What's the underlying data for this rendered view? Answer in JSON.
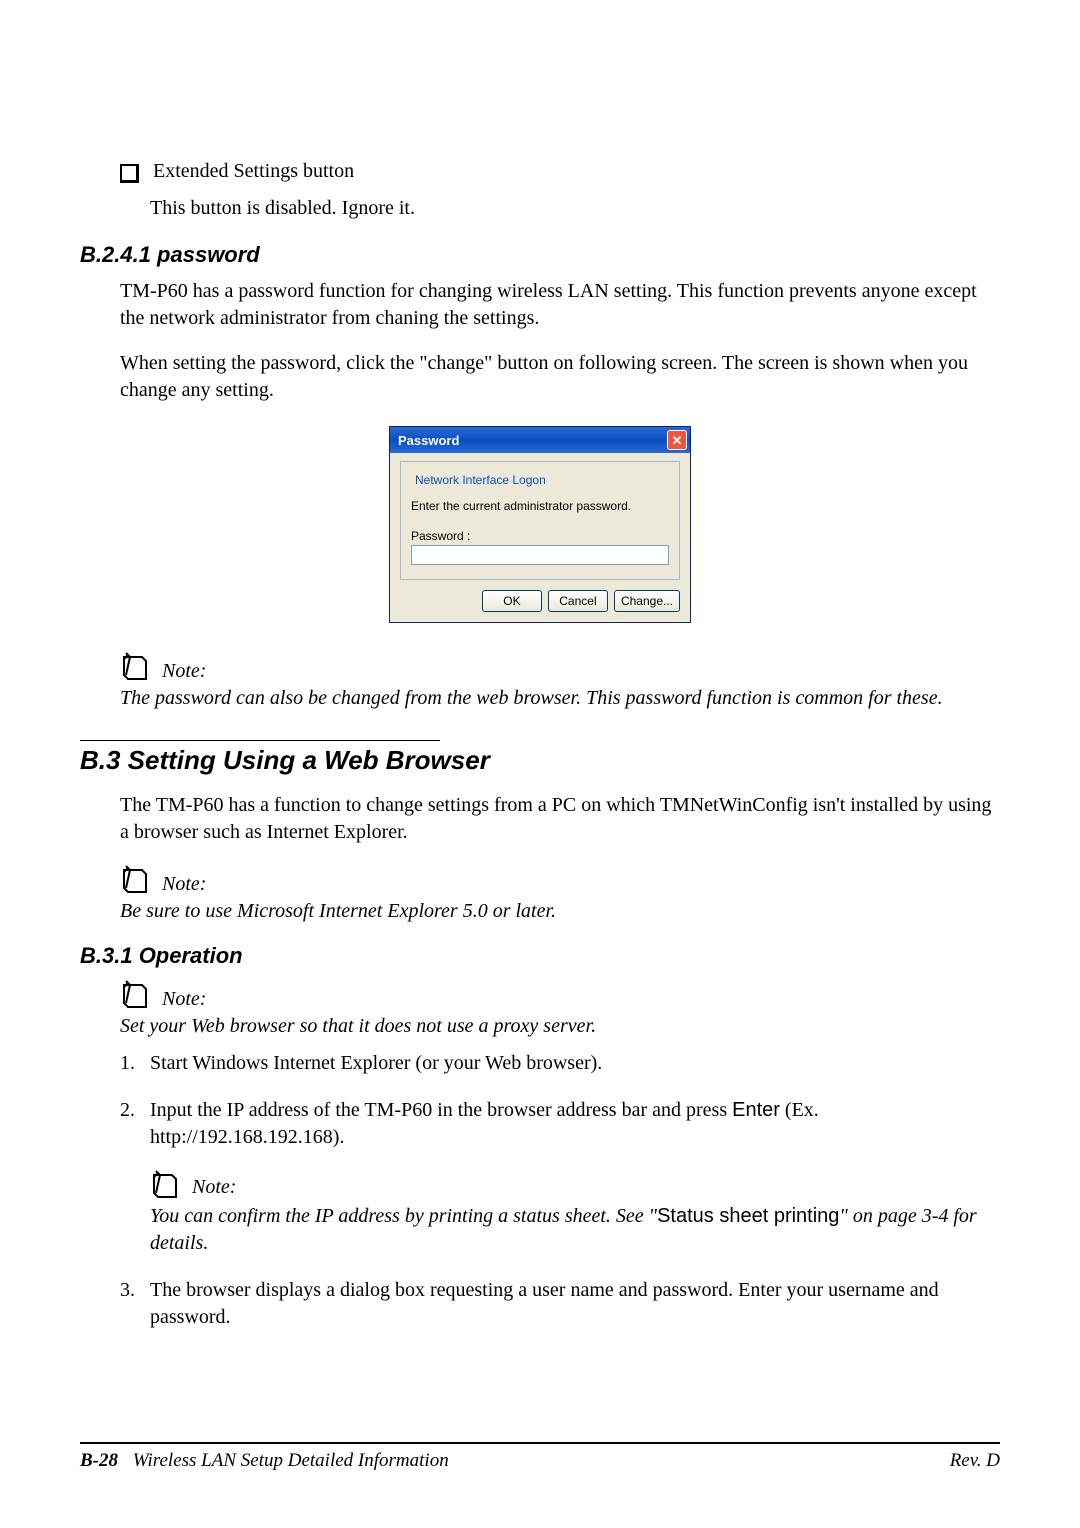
{
  "bullet": {
    "title": "Extended Settings button",
    "desc": "This button is disabled. Ignore it."
  },
  "sectionB241": {
    "heading": "B.2.4.1  password",
    "p1": "TM-P60 has a password function for changing wireless LAN setting. This function prevents anyone except the network administrator from chaning the settings.",
    "p2": "When setting the password, click the \"change\" button on following screen. The screen is shown when you change any setting."
  },
  "dialog": {
    "title": "Password",
    "group": "Network Interface Logon",
    "prompt": "Enter the current administrator password.",
    "pw_label": "Password :",
    "pw_value": "",
    "ok": "OK",
    "cancel": "Cancel",
    "change": "Change..."
  },
  "note1": {
    "label": "Note:",
    "text": "The password can also be changed from the web browser. This password function is common for these."
  },
  "sectionB3": {
    "heading": "B.3  Setting Using a Web Browser",
    "p1": "The TM-P60 has a function to change settings from a PC on which TMNetWinConfig isn't installed by using a browser such as Internet Explorer."
  },
  "note2": {
    "label": "Note:",
    "text": "Be sure to use Microsoft Internet Explorer 5.0 or later."
  },
  "sectionB31": {
    "heading": "B.3.1  Operation"
  },
  "note3": {
    "label": "Note:",
    "text": "Set your Web browser so that it does not use a proxy server."
  },
  "steps": {
    "s1": "Start Windows Internet Explorer (or your Web browser).",
    "s2_a": "Input the IP address of the TM-P60 in the browser address bar and press ",
    "s2_enter": "Enter",
    "s2_b": " (Ex. http://192.168.192.168).",
    "s3": "The browser displays a dialog box requesting a user name and password. Enter your username and password."
  },
  "note4": {
    "label": "Note:",
    "text_a": "You can confirm the IP address by printing a status sheet. See \"",
    "text_link": "Status sheet printing",
    "text_b": "\" on page 3-4 for details."
  },
  "footer": {
    "page": "B-28",
    "title": "Wireless LAN Setup Detailed Information",
    "rev": "Rev. D"
  }
}
